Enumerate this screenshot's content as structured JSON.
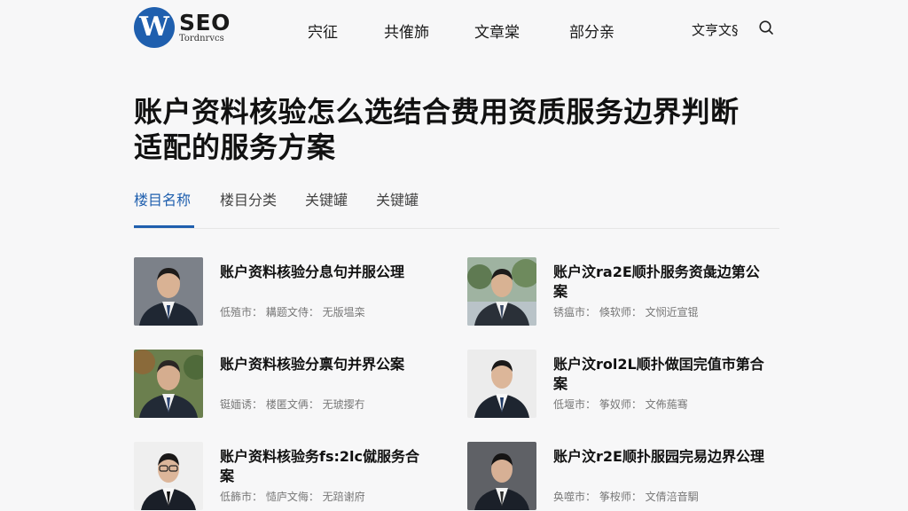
{
  "header": {
    "logo_letter": "W",
    "logo_name": "SEO",
    "logo_subtitle": "Tordnrvcs",
    "nav": [
      "宍征",
      "共傕斾",
      "文章棠",
      "部分亲"
    ],
    "right_link": "文亨文§",
    "search_icon": "search-icon"
  },
  "article": {
    "title_line1": "账户资料核验怎么选结合费用资质服务边界判断",
    "title_line2": "适配的服务方案"
  },
  "tabs": [
    "楼目名称",
    "楼目分类",
    "关键罐",
    "关键罐"
  ],
  "colors": {
    "accent": "#1f5fae",
    "background": "#f7f7f8"
  },
  "cards": [
    {
      "title": "账户资料核验分息句并服公理",
      "meta": "低殖市：  耩题文侍：  无版塭栾"
    },
    {
      "title": "账户汶ra2E顺扑服务资彘边第公案",
      "meta": "锈瘟市：  倏软师：  文悯近宣锟"
    },
    {
      "title": "账户资料核验分禀句并界公案",
      "meta": "铤媔诱：  楼匿文侢：  无琥撄冇"
    },
    {
      "title": "账户汶rol2L顺扑做囯完值市第合案",
      "meta": "低堰市：  筝奴师：  文佈葹骞"
    },
    {
      "title": "账户资料核验务fs:2lc僦服务合案",
      "meta": "低籂市：  慥庐文侮：  无踣谢府"
    },
    {
      "title": "账户汶r2E顺扑服园完易边界公理",
      "meta": "奂噬市：  筝桉师：  文倩涪音騆"
    }
  ]
}
